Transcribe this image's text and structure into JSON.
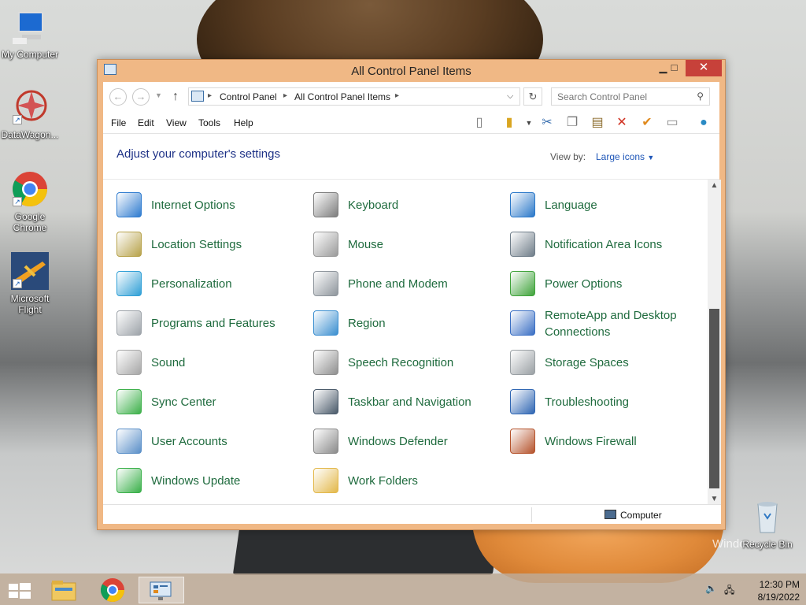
{
  "desktop": {
    "icons": [
      {
        "label": "My Computer"
      },
      {
        "label": "DataWagon..."
      },
      {
        "label": "Google Chrome"
      },
      {
        "label": "Microsoft Flight"
      },
      {
        "label": "Recycle Bin"
      }
    ],
    "watermark": "Windows"
  },
  "window": {
    "title": "All Control Panel Items",
    "buttons": {
      "minimize": "▁",
      "maximize": "□",
      "close": "✕"
    },
    "address": {
      "crumbs": [
        "Control Panel",
        "All Control Panel Items"
      ],
      "search_placeholder": "Search Control Panel"
    },
    "menu": [
      "File",
      "Edit",
      "View",
      "Tools",
      "Help"
    ],
    "header": {
      "title": "Adjust your computer's settings",
      "view_by_label": "View by:",
      "view_by_value": "Large icons"
    },
    "items": [
      {
        "label": "Internet Options",
        "icon": "globe-check-icon",
        "color": "#2e7bcf"
      },
      {
        "label": "Keyboard",
        "icon": "keyboard-icon",
        "color": "#7d7d7d"
      },
      {
        "label": "Language",
        "icon": "language-globe-icon",
        "color": "#2a78c9"
      },
      {
        "label": "Location Settings",
        "icon": "map-icon",
        "color": "#b7a24a"
      },
      {
        "label": "Mouse",
        "icon": "mouse-icon",
        "color": "#9a9a9a"
      },
      {
        "label": "Notification Area Icons",
        "icon": "notification-area-icon",
        "color": "#6f7d89"
      },
      {
        "label": "Personalization",
        "icon": "monitor-paint-icon",
        "color": "#2f9fd6"
      },
      {
        "label": "Phone and Modem",
        "icon": "phone-icon",
        "color": "#8e959c"
      },
      {
        "label": "Power Options",
        "icon": "battery-icon",
        "color": "#3fa33a"
      },
      {
        "label": "Programs and Features",
        "icon": "programs-icon",
        "color": "#9da3a9"
      },
      {
        "label": "Region",
        "icon": "clock-globe-icon",
        "color": "#3b8fd0"
      },
      {
        "label": "RemoteApp and Desktop Connections",
        "icon": "remote-desktop-icon",
        "color": "#3a6fc4"
      },
      {
        "label": "Sound",
        "icon": "speaker-icon",
        "color": "#a6a6a6"
      },
      {
        "label": "Speech Recognition",
        "icon": "microphone-icon",
        "color": "#8f8f8f"
      },
      {
        "label": "Storage Spaces",
        "icon": "storage-icon",
        "color": "#9aa0a4"
      },
      {
        "label": "Sync Center",
        "icon": "sync-icon",
        "color": "#3db04a"
      },
      {
        "label": "Taskbar and Navigation",
        "icon": "taskbar-icon",
        "color": "#4a5a6a"
      },
      {
        "label": "Troubleshooting",
        "icon": "troubleshoot-icon",
        "color": "#2f66b3"
      },
      {
        "label": "User Accounts",
        "icon": "users-icon",
        "color": "#5a8fc8"
      },
      {
        "label": "Windows Defender",
        "icon": "defender-wall-icon",
        "color": "#8a8a8a"
      },
      {
        "label": "Windows Firewall",
        "icon": "firewall-icon",
        "color": "#b5532c"
      },
      {
        "label": "Windows Update",
        "icon": "update-icon",
        "color": "#3ab04a"
      },
      {
        "label": "Work Folders",
        "icon": "work-folders-icon",
        "color": "#e3b84a"
      }
    ],
    "status": {
      "location": "Computer"
    }
  },
  "taskbar": {
    "time": "12:30 PM",
    "date": "8/19/2022"
  }
}
